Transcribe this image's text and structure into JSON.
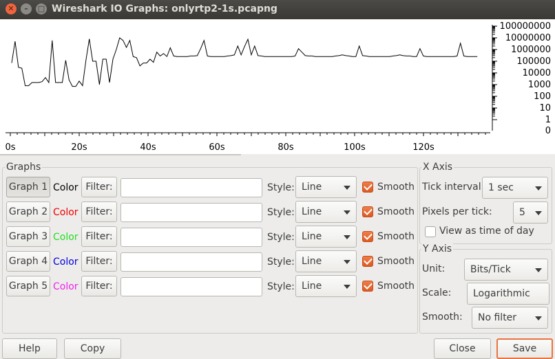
{
  "window": {
    "title": "Wireshark IO Graphs: onlyrtp2-1s.pcapng",
    "close_glyph": "✕",
    "min_glyph": "–",
    "max_glyph": "□"
  },
  "chart_data": {
    "type": "line",
    "y_scale": "log",
    "x_tick_labels": [
      "0s",
      "20s",
      "40s",
      "60s",
      "80s",
      "100s",
      "120s"
    ],
    "y_tick_labels": [
      "100000000",
      "10000000",
      "1000000",
      "100000",
      "10000",
      "1000",
      "100",
      "10",
      "1",
      "0"
    ],
    "x": [
      0,
      1,
      2,
      3,
      4,
      5,
      6,
      7,
      8,
      9,
      10,
      11,
      12,
      13,
      14,
      15,
      16,
      17,
      18,
      19,
      20,
      21,
      22,
      23,
      24,
      25,
      26,
      27,
      28,
      29,
      30,
      31,
      32,
      33,
      34,
      35,
      36,
      37,
      38,
      39,
      40,
      41,
      42,
      43,
      44,
      45,
      46,
      47,
      48,
      49,
      50,
      51,
      52,
      53,
      54,
      55,
      56,
      57,
      58,
      59,
      60,
      61,
      62,
      63,
      64,
      65,
      66,
      67,
      68,
      69,
      70,
      71,
      72,
      73,
      74,
      75,
      76,
      77,
      78,
      79,
      80,
      81,
      82,
      83,
      84,
      85,
      86,
      87,
      88,
      89,
      90,
      91,
      92,
      93,
      94,
      95,
      96,
      97,
      98,
      99,
      100,
      101,
      102,
      103,
      104,
      105,
      106,
      107,
      108,
      109,
      110,
      111,
      112,
      113,
      114,
      115,
      116,
      117,
      118,
      119,
      120,
      121,
      122,
      123,
      124,
      125,
      126,
      127,
      128,
      129,
      130,
      131,
      132,
      133,
      134,
      135,
      136,
      137,
      138
    ],
    "y": [
      70000,
      5000000,
      30000,
      25000,
      800,
      800,
      1500,
      1500,
      1500,
      1800,
      4000,
      1500,
      6000000,
      1500,
      1500,
      1500,
      120000,
      2500,
      700,
      700,
      2000,
      800,
      120000,
      8000000,
      100000,
      100000,
      1000,
      150000,
      150000,
      1500,
      150000,
      1000000,
      10000000,
      6000000,
      1500000,
      6000000,
      250000,
      200000,
      40000,
      70000,
      70000,
      150000,
      80000,
      600000,
      280000,
      450000,
      250000,
      1400000,
      280000,
      250000,
      250000,
      250000,
      250000,
      280000,
      280000,
      300000,
      1200000,
      6000000,
      280000,
      250000,
      250000,
      250000,
      250000,
      250000,
      280000,
      300000,
      350000,
      2000000,
      350000,
      1800000,
      7500000,
      350000,
      2000000,
      300000,
      280000,
      250000,
      250000,
      250000,
      250000,
      250000,
      250000,
      250000,
      250000,
      250000,
      280000,
      1200000,
      600000,
      300000,
      280000,
      280000,
      250000,
      250000,
      250000,
      250000,
      250000,
      250000,
      280000,
      300000,
      350000,
      300000,
      280000,
      250000,
      250000,
      2000000,
      300000,
      280000,
      250000,
      250000,
      250000,
      250000,
      250000,
      250000,
      250000,
      280000,
      300000,
      350000,
      300000,
      280000,
      280000,
      250000,
      250000,
      1200000,
      280000,
      250000,
      250000,
      250000,
      250000,
      250000,
      250000,
      250000,
      250000,
      250000,
      280000,
      3500000,
      280000,
      250000,
      250000,
      250000,
      250000,
      250000,
      250000
    ]
  },
  "graphs": {
    "title": "Graphs",
    "filter_label": "Filter:",
    "style_label": "Style:",
    "smooth_label": "Smooth",
    "rows": [
      {
        "button": "Graph 1",
        "color_label": "Color",
        "color": "#000000",
        "style": "Line",
        "smooth": true
      },
      {
        "button": "Graph 2",
        "color_label": "Color",
        "color": "#ee0000",
        "style": "Line",
        "smooth": true
      },
      {
        "button": "Graph 3",
        "color_label": "Color",
        "color": "#22dd22",
        "style": "Line",
        "smooth": true
      },
      {
        "button": "Graph 4",
        "color_label": "Color",
        "color": "#0000dd",
        "style": "Line",
        "smooth": true
      },
      {
        "button": "Graph 5",
        "color_label": "Color",
        "color": "#ee22ee",
        "style": "Line",
        "smooth": true
      }
    ]
  },
  "x_axis": {
    "title": "X Axis",
    "tick_interval_label": "Tick interval:",
    "tick_interval_value": "1 sec",
    "pixels_per_tick_label": "Pixels per tick:",
    "pixels_per_tick_value": "5",
    "view_as_time_label": "View as time of day",
    "view_as_time_checked": false
  },
  "y_axis": {
    "title": "Y Axis",
    "unit_label": "Unit:",
    "unit_value": "Bits/Tick",
    "scale_label": "Scale:",
    "scale_value": "Logarithmic",
    "smooth_label": "Smooth:",
    "smooth_value": "No filter"
  },
  "footer": {
    "help": "Help",
    "copy": "Copy",
    "close": "Close",
    "save": "Save"
  }
}
